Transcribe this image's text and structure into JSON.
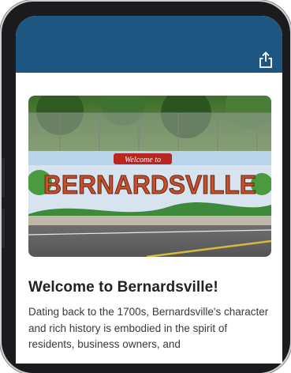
{
  "header": {
    "share_icon": "share-icon",
    "color": "#1f5681"
  },
  "hero": {
    "mural_text": "BERNARDSVILLE",
    "banner_text": "Welcome to"
  },
  "article": {
    "title": "Welcome to Bernardsville!",
    "body": "Dating back to the 1700s, Bernardsville's character and rich history is embodied in the spirit of residents, business owners, and"
  }
}
